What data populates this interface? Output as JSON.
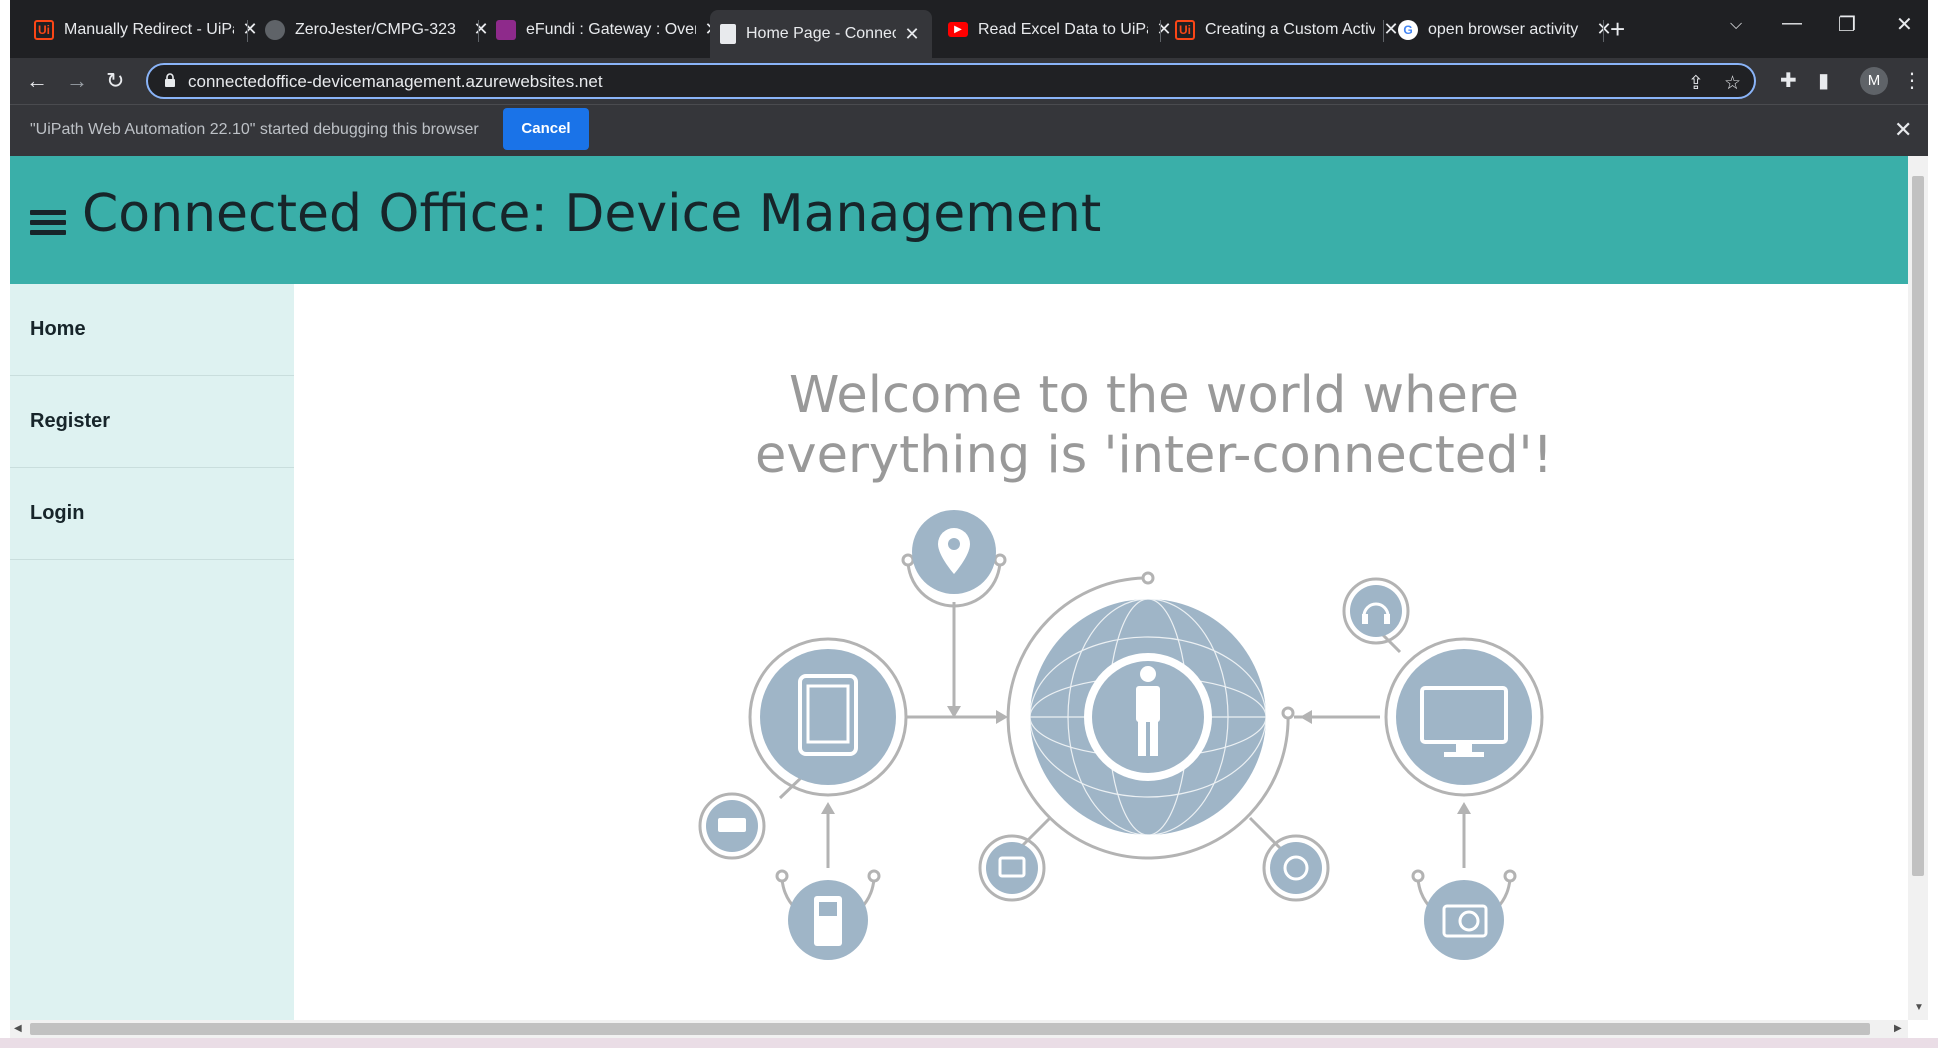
{
  "browser": {
    "tabs": [
      {
        "title": "Manually Redirect - UiPath Community",
        "favicon": "uipath-icon",
        "favicon_text": "Ui",
        "color": "#fa4616"
      },
      {
        "title": "ZeroJester/CMPG-323",
        "favicon": "github-icon",
        "favicon_text": "",
        "color": "#e8eaed"
      },
      {
        "title": "eFundi : Gateway : Overview",
        "favicon": "efundi-icon",
        "favicon_text": "",
        "color": "#8e2a8b"
      },
      {
        "title": "Home Page - Connected Office",
        "favicon": "page-icon",
        "favicon_text": "",
        "color": "#8ab4f8"
      },
      {
        "title": "Read Excel Data to UiPath",
        "favicon": "youtube-icon",
        "favicon_text": "▶",
        "color": "#ff0000"
      },
      {
        "title": "Creating a Custom Activity",
        "favicon": "uipath-icon",
        "favicon_text": "Ui",
        "color": "#fa4616"
      },
      {
        "title": "open browser activity",
        "favicon": "google-icon",
        "favicon_text": "G",
        "color": "#ffffff"
      }
    ],
    "active_tab_index": 3,
    "url": "connectedoffice-devicemanagement.azurewebsites.net",
    "profile_initial": "M",
    "infobar": {
      "message": "\"UiPath Web Automation 22.10\" started debugging this browser",
      "cancel_label": "Cancel"
    }
  },
  "page": {
    "header_title": "Connected Office: Device Management",
    "nav": [
      {
        "label": "Home"
      },
      {
        "label": "Register"
      },
      {
        "label": "Login"
      }
    ],
    "welcome": "Welcome to the world where everything is 'inter-connected'!"
  },
  "colors": {
    "header": "#3aafa9",
    "sidebar": "#def2f1",
    "dark_text": "#17252a",
    "illustration": "#9fb5c7",
    "accent_blue": "#1a73e8"
  }
}
